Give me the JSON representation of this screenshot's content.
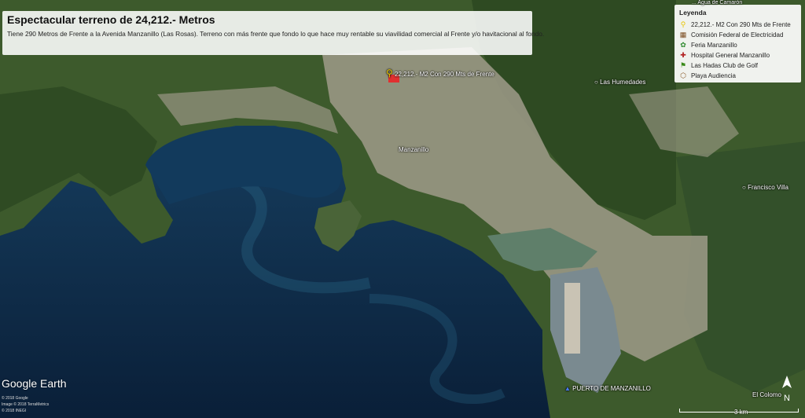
{
  "header": {
    "title": "Espectacular terreno de 24,212.- Metros",
    "description": "Tiene 290 Metros de Frente a la Avenida Manzanillo (Las Rosas). Terreno con más frente que fondo lo que hace muy rentable su viavilidad comercial al Frente y/o havitacional al fondo."
  },
  "legend": {
    "title": "Leyenda",
    "items": [
      {
        "label": "22,212.- M2 Con 290 Mts de Frente",
        "icon": "yellow-pushpin-icon",
        "color": "#e8c400"
      },
      {
        "label": "Comisión Federal de Electricidad",
        "icon": "building-icon",
        "color": "#7a4a1e"
      },
      {
        "label": "Feria Manzanillo",
        "icon": "fair-icon",
        "color": "#2f8a2f"
      },
      {
        "label": "Hospital General Manzanillo",
        "icon": "hospital-icon",
        "color": "#b22222"
      },
      {
        "label": "Las Hadas Club de Golf",
        "icon": "golf-flag-icon",
        "color": "#3a8a1a"
      },
      {
        "label": "Playa Audiencia",
        "icon": "beach-icon",
        "color": "#8a5a2a"
      }
    ]
  },
  "places": {
    "pin_label": "22,212.- M2 Con 290 Mts de Frente",
    "las_humedades": "Las Humedades",
    "manzanillo": "Manzanillo",
    "francisco_villa": "Francisco Villa",
    "puerto": "PUERTO DE MANZANILLO",
    "el_colomo": "El Colomo",
    "top_right_place": "... Agua de Camarón"
  },
  "branding": {
    "logo": "Google Earth",
    "credits": [
      "© 2018 Google",
      "Image © 2018 TerraMetrics",
      "© 2018 INEGI"
    ]
  },
  "scale": {
    "label": "3 km"
  },
  "compass": {
    "label": "N"
  },
  "colors": {
    "ocean": "#0f2a44",
    "land": "#3d5a2c",
    "urban": "#a9a596",
    "pin": "#e8c400",
    "lot": "#e03030"
  }
}
